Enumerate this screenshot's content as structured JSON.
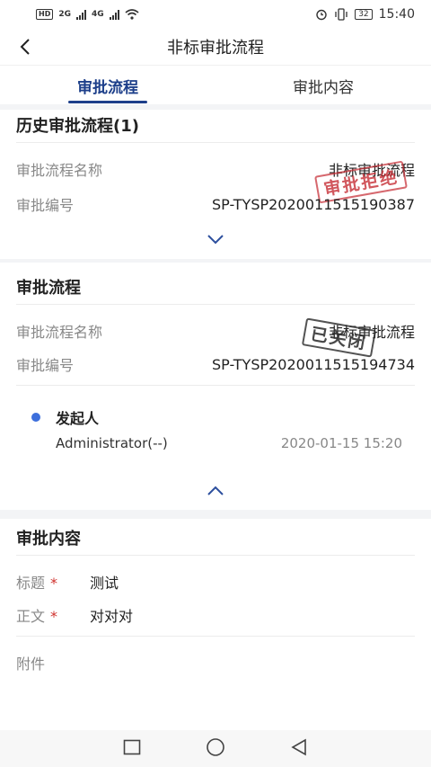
{
  "status_bar": {
    "network_left": [
      "HD",
      "2G",
      "4G"
    ],
    "time": "15:40",
    "battery": "32"
  },
  "header": {
    "title": "非标审批流程"
  },
  "tabs": [
    {
      "label": "审批流程",
      "active": true
    },
    {
      "label": "审批内容",
      "active": false
    }
  ],
  "history": {
    "title": "历史审批流程(1)",
    "name_label": "审批流程名称",
    "name_value": "非标审批流程",
    "number_label": "审批编号",
    "number_value": "SP-TYSP2020011515190387",
    "stamp": "审批拒绝"
  },
  "current": {
    "title": "审批流程",
    "name_label": "审批流程名称",
    "name_value": "非标审批流程",
    "number_label": "审批编号",
    "number_value": "SP-TYSP2020011515194734",
    "stamp": "已关闭",
    "step": {
      "role": "发起人",
      "user": "Administrator(--)",
      "time": "2020-01-15 15:20"
    }
  },
  "content": {
    "title": "审批内容",
    "fields": [
      {
        "label": "标题",
        "required_mark": "*",
        "value": "测试"
      },
      {
        "label": "正文",
        "required_mark": "*",
        "value": "对对对"
      }
    ],
    "attachment_label": "附件"
  },
  "colors": {
    "accent": "#1d3f8a",
    "stamp_red": "#c42830",
    "dot_blue": "#3d6fdc",
    "required": "#d0312d"
  }
}
